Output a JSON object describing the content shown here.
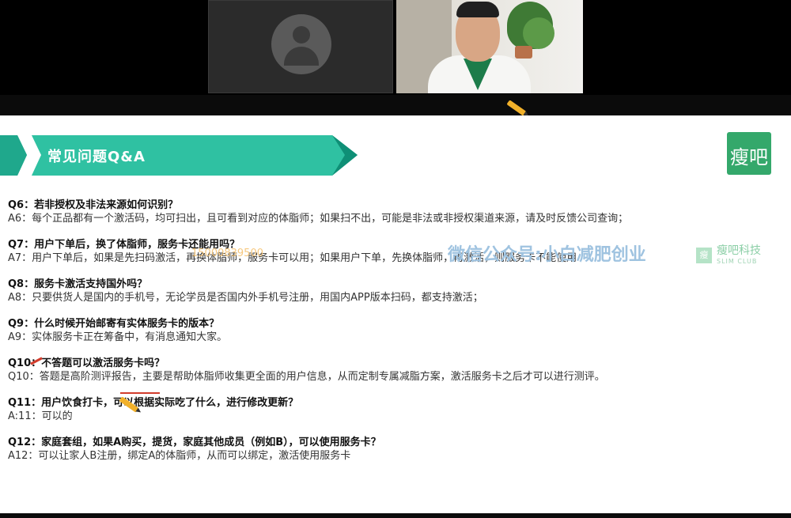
{
  "slide": {
    "title": "常见问题Q&A",
    "logo_text": "瘦吧",
    "items": [
      {
        "q": "Q6：若非授权及非法来源如何识别？",
        "a": "A6：每个正品都有一个激活码，均可扫出，且可看到对应的体脂师；如果扫不出，可能是非法或非授权渠道来源，请及时反馈公司查询；"
      },
      {
        "q": "Q7：用户下单后，换了体脂师，服务卡还能用吗？",
        "a": "A7：用户下单后，如果是先扫码激活，再换体脂师，服务卡可以用；如果用户下单，先换体脂师，再激活，则服务卡不能使用"
      },
      {
        "q": "Q8：服务卡激活支持国外吗？",
        "a": "A8：只要供货人是国内的手机号，无论学员是否国内外手机号注册，用国内APP版本扫码，都支持激活；"
      },
      {
        "q": "Q9：什么时候开始邮寄有实体服务卡的版本？",
        "a": "A9：实体服务卡正在筹备中，有消息通知大家。"
      },
      {
        "q": "Q10：不答题可以激活服务卡吗？",
        "a": "Q10：答题是高阶测评报告，主要是帮助体脂师收集更全面的用户信息，从而定制专属减脂方案，激活服务卡之后才可以进行测评。"
      },
      {
        "q": "Q11：用户饮食打卡，可以根据实际吃了什么，进行修改更新？",
        "a": "A:11：可以的"
      },
      {
        "q": "Q12：家庭套组，如果A购买，提货，家庭其他成员（例如B），可以使用服务卡？",
        "a": "A12：可以让家人B注册，绑定A的体脂师，从而可以绑定，激活使用服务卡"
      }
    ]
  },
  "watermarks": {
    "orange_number": "15000839500",
    "center_text": "微信公众号:小白减肥创业",
    "brand_name": "瘦吧科技",
    "brand_sub": "SLIM CLUB",
    "badge": "瘦"
  },
  "colors": {
    "banner": "#2fc1a2",
    "banner_dark": "#0f8f76",
    "logo": "#34a86b"
  }
}
